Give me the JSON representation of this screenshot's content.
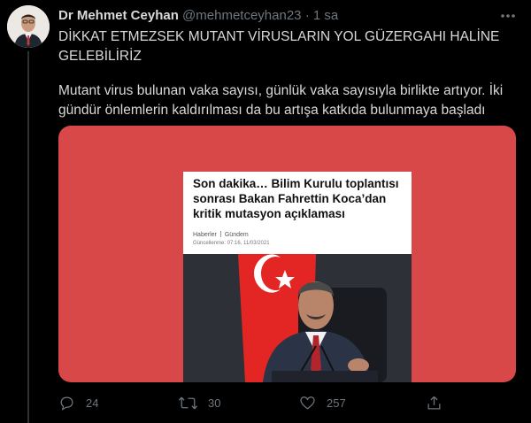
{
  "tweet": {
    "author_name": "Dr Mehmet Ceyhan",
    "handle": "@mehmetceyhan23",
    "separator": "·",
    "time": "1 sa",
    "text_line1": "DİKKAT ETMEZSEK MUTANT VİRUSLARIN YOL GÜZERGAHI HALİNE GELEBİLİRİZ",
    "text_line2": "Mutant virus bulunan vaka sayısı, günlük vaka sayısıyla birlikte artıyor. İki gündür önlemlerin kaldırılması da bu artışa katkıda bulunmaya başladı"
  },
  "media": {
    "headline": "Son dakika… Bilim Kurulu toplantısı sonrası Bakan Fahrettin Koca’dan kritik mutasyon açıklaması",
    "crumb_1": "Haberler",
    "crumb_2": "Gündem",
    "updated": "Güncellenme: 07:16, 11/03/2021"
  },
  "actions": {
    "reply_count": "24",
    "retweet_count": "30",
    "like_count": "257"
  },
  "icons": {
    "more": "more-icon",
    "reply": "reply-icon",
    "retweet": "retweet-icon",
    "like": "heart-icon",
    "share": "share-icon"
  },
  "colors": {
    "background": "#000000",
    "media_background": "#d94848",
    "muted": "#6e767d",
    "text": "#d9d9d9"
  }
}
